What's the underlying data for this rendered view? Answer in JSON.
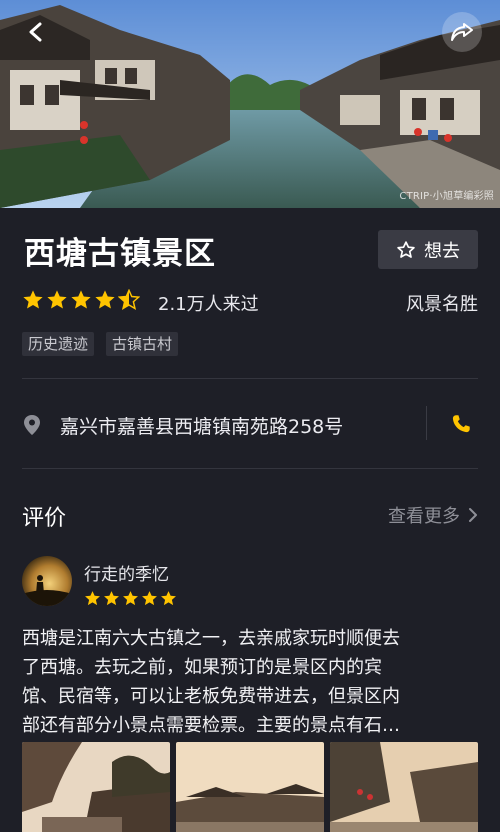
{
  "hero": {
    "watermark": "CTRIP·小旭草编彩照",
    "back_icon": "back-arrow-icon",
    "share_icon": "share-icon"
  },
  "scenic": {
    "title": "西塘古镇景区",
    "want_label": "想去",
    "rating": 4.5,
    "rating_max": 5,
    "visited": "2.1万人来过",
    "category": "风景名胜",
    "tags": [
      "历史遗迹",
      "古镇古村"
    ]
  },
  "address": {
    "text": "嘉兴市嘉善县西塘镇南苑路258号",
    "pin_icon": "location-pin-icon",
    "phone_icon": "phone-icon"
  },
  "reviews": {
    "title": "评价",
    "more_label": "查看更多",
    "items": [
      {
        "user": "行走的季忆",
        "stars": 5,
        "lines": [
          "西塘是江南六大古镇之一，去亲戚家玩时顺便去",
          "了西塘。去玩之前，如果预订的是景区内的宾",
          "馆、民宿等，可以让老板免费带进去，但景区内",
          "部还有部分小景点需要检票。主要的景点有石…"
        ]
      }
    ]
  },
  "colors": {
    "background": "#1e1f27",
    "star": "#ffc400",
    "phone": "#ffc400",
    "muted": "#8e8f97"
  }
}
